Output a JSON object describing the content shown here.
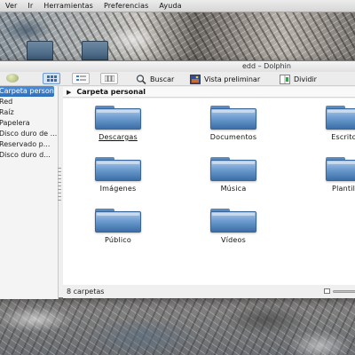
{
  "menubar": {
    "items": [
      "Ver",
      "Ir",
      "Herramientas",
      "Preferencias",
      "Ayuda"
    ]
  },
  "window": {
    "title": "edd – Dolphin"
  },
  "toolbar": {
    "search_label": "Buscar",
    "preview_label": "Vista preliminar",
    "split_label": "Dividir",
    "active_view": "icons"
  },
  "sidebar": {
    "items": [
      {
        "label": "Carpeta personal",
        "selected": true
      },
      {
        "label": "Red",
        "selected": false
      },
      {
        "label": "Raíz",
        "selected": false
      },
      {
        "label": "Papelera",
        "selected": false
      },
      {
        "label": "Disco duro de ...",
        "selected": false
      },
      {
        "label": "Reservado p...",
        "selected": false
      },
      {
        "label": "Disco duro d...",
        "selected": false
      }
    ]
  },
  "location": {
    "crumb": "Carpeta personal"
  },
  "folders": [
    {
      "name": "Descargas",
      "hover": true
    },
    {
      "name": "Documentos",
      "hover": false
    },
    {
      "name": "Escritorio",
      "hover": false
    },
    {
      "name": "Imágenes",
      "hover": false
    },
    {
      "name": "Música",
      "hover": false
    },
    {
      "name": "Plantillas",
      "hover": false
    },
    {
      "name": "Público",
      "hover": false
    },
    {
      "name": "Vídeos",
      "hover": false
    }
  ],
  "status": {
    "text": "8 carpetas"
  },
  "colors": {
    "selection": "#3a7bc8",
    "folder": "#6d9ccf"
  }
}
